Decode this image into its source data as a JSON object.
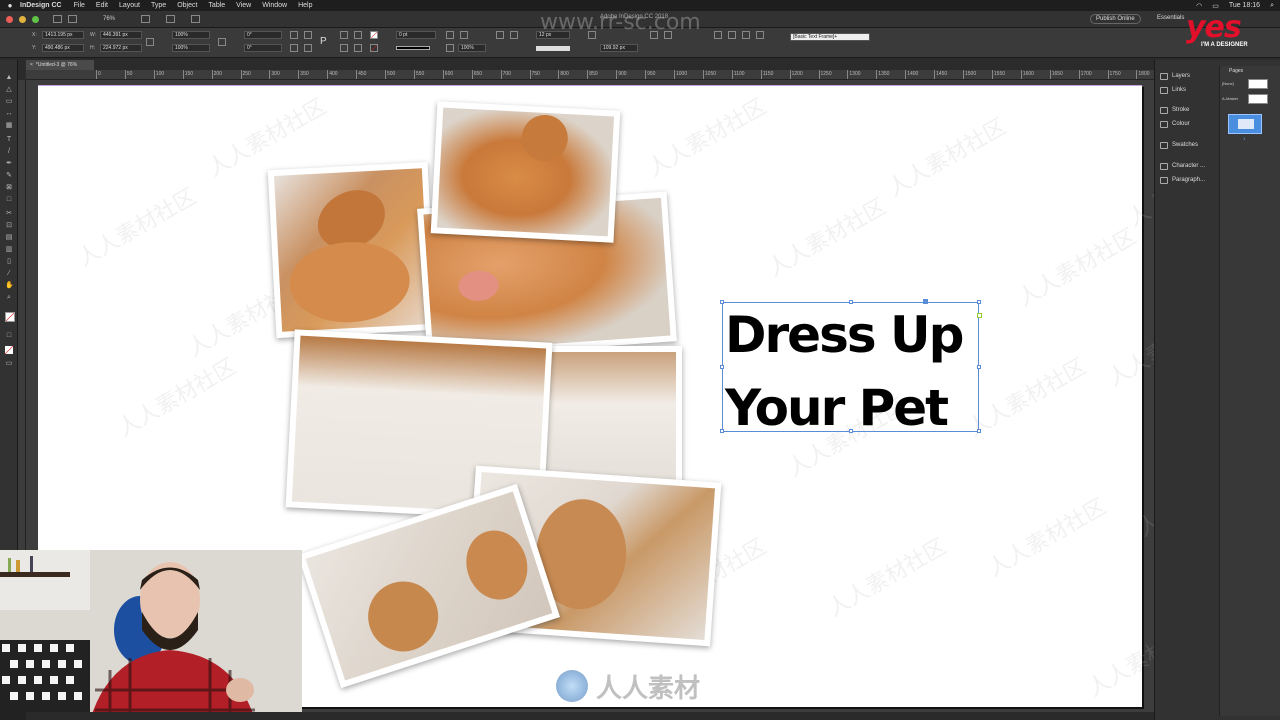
{
  "menubar": {
    "app_name": "InDesign CC",
    "menus": [
      "File",
      "Edit",
      "Layout",
      "Type",
      "Object",
      "Table",
      "View",
      "Window",
      "Help"
    ],
    "clock": "Tue 18:16",
    "watermark_url": "www.rr-sc.com"
  },
  "appbar": {
    "window_title": "Adobe InDesign CC 2018",
    "zoom": "76%",
    "publish_label": "Publish Online",
    "workspace": "Essentials"
  },
  "control": {
    "x": "1413.195 px",
    "y": "490.486 px",
    "w": "446.391 px",
    "h": "224.972 px",
    "scale_x": "100%",
    "scale_y": "100%",
    "rotate": "0°",
    "shear": "0°",
    "stroke_weight": "0 pt",
    "opacity": "100%",
    "gutter": "12 px",
    "width2": "109.92 px",
    "object_style": "[Basic Text Frame]+"
  },
  "document": {
    "tab_label": "*Untitled-3 @ 76%"
  },
  "ruler": {
    "labels": [
      "0",
      "50",
      "100",
      "150",
      "200",
      "250",
      "300",
      "350",
      "400",
      "450",
      "500",
      "550",
      "600",
      "650",
      "700",
      "750",
      "800",
      "850",
      "900",
      "950",
      "1000",
      "1050",
      "1100",
      "1150",
      "1200",
      "1250",
      "1300",
      "1350",
      "1400",
      "1450",
      "1500",
      "1550",
      "1600",
      "1650",
      "1700",
      "1750",
      "1800",
      "1850",
      "1900"
    ]
  },
  "artwork": {
    "headline_line1": "Dress Up",
    "headline_line2": "Your Pet"
  },
  "panels": {
    "dock": [
      "Layers",
      "Links",
      "Stroke",
      "Colour",
      "Swatches",
      "Character ...",
      "Paragraph..."
    ],
    "pages_title": "Pages",
    "none_label": "[None]",
    "master_label": "A-Master",
    "page_number": "1"
  },
  "brand": {
    "logo": "yes",
    "tagline": "I'M A DESIGNER"
  },
  "watermark": {
    "site_text": "人人素材",
    "repeat_text": "人人素材社区"
  },
  "colors": {
    "selection": "#5a8dd6",
    "brand_red": "#e2102a",
    "page": "#ffffff",
    "pasteboard": "#3d3d3d"
  }
}
